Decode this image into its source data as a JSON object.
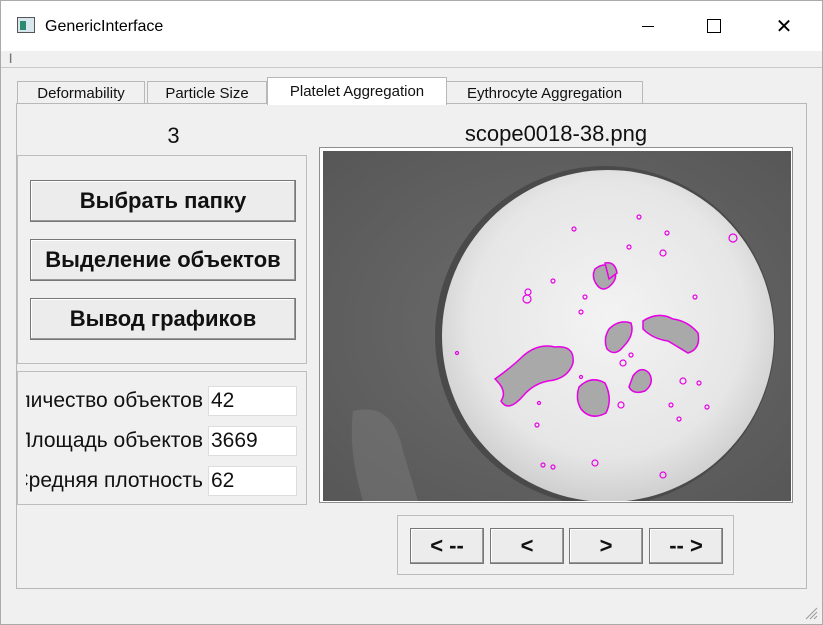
{
  "window": {
    "title": "GenericInterface"
  },
  "tabs": [
    {
      "label": "Deformability",
      "active": false
    },
    {
      "label": "Particle Size",
      "active": false
    },
    {
      "label": "Platelet Aggregation",
      "active": true
    },
    {
      "label": "Eythrocyte Aggregation",
      "active": false
    }
  ],
  "viewer": {
    "counter": "3",
    "filename": "scope0018-38.png"
  },
  "actions": {
    "select_folder": "Выбрать папку",
    "select_objects": "Выделение объектов",
    "output_charts": "Вывод графиков"
  },
  "stats": [
    {
      "label": "Количество объектов",
      "value": "42"
    },
    {
      "label": "Площадь объектов",
      "value": "3669"
    },
    {
      "label": "Средняя плотность",
      "value": "62"
    }
  ],
  "navigation": {
    "first": "< --",
    "prev": "<",
    "next": ">",
    "last": "-- >"
  },
  "colors": {
    "contour": "#e600e6",
    "background": "#f0f0f0"
  }
}
